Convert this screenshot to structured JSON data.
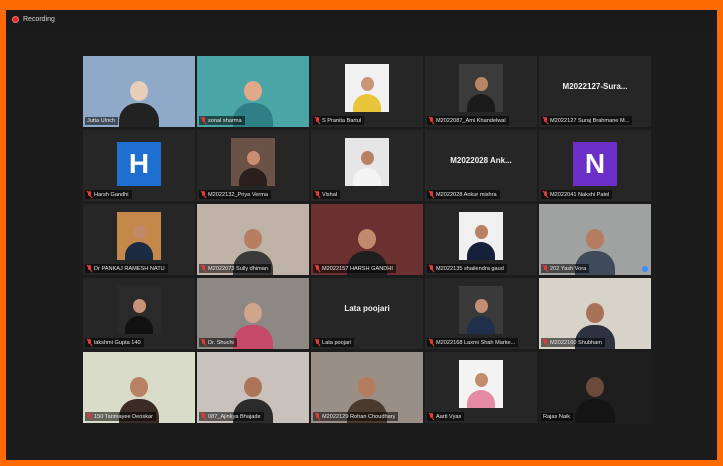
{
  "topbar": {
    "recording_label": "Recording"
  },
  "colors": {
    "frame": "#ff6a00",
    "active_speaker": "#d8e23a",
    "mic_muted": "#e23a3a",
    "avatar_h": "#1f6fd0",
    "avatar_n": "#6b2fc8"
  },
  "participants": [
    {
      "label": "Jutta Ulrich",
      "muted": false,
      "kind": "video",
      "bg": "#8fa9c8",
      "skin": "#e8cdb8",
      "shirt": "#222",
      "active": true
    },
    {
      "label": "sonal sharma",
      "muted": true,
      "kind": "video",
      "bg": "#4aa6a6",
      "skin": "#e0a98a",
      "shirt": "#2f7f86"
    },
    {
      "label": "S Pranita Bartul",
      "muted": true,
      "kind": "thumb",
      "bg": "#f1f1f1",
      "skin": "#c99677",
      "shirt": "#e8c53a"
    },
    {
      "label": "M2022087_Ami Khandelwal",
      "muted": true,
      "kind": "thumb",
      "bg": "#3b3b3b",
      "skin": "#b98567",
      "shirt": "#1b1b1b"
    },
    {
      "label": "M2022127 Suraj Brahmane M...",
      "muted": true,
      "kind": "name",
      "name_text": "M2022127-Sura..."
    },
    {
      "label": "Harsh Gandhi",
      "muted": true,
      "kind": "avatar",
      "letter": "H",
      "avatar_color": "#1f6fd0"
    },
    {
      "label": "M2022132_Priya Verma",
      "muted": true,
      "kind": "thumb",
      "bg": "#6a5246",
      "skin": "#c98d70",
      "shirt": "#2a1f1c"
    },
    {
      "label": "Vishal",
      "muted": true,
      "kind": "thumb",
      "bg": "#e6e6e6",
      "skin": "#b98063",
      "shirt": "#f4f4f4"
    },
    {
      "label": "M2022028 Ankur mishra",
      "muted": true,
      "kind": "name",
      "name_text": "M2022028 Ank..."
    },
    {
      "label": "M2022041 Nakshi Patel",
      "muted": true,
      "kind": "avatar",
      "letter": "N",
      "avatar_color": "#6b2fc8"
    },
    {
      "label": "Dr PANKAJ RAMESH NATU",
      "muted": true,
      "kind": "thumb",
      "bg": "#c4884a",
      "skin": "#c08a68",
      "shirt": "#1c2a44"
    },
    {
      "label": "M2022073 Sully dhiman",
      "muted": true,
      "kind": "video",
      "bg": "#bfb3a7",
      "skin": "#b77e61",
      "shirt": "#3a3a3a"
    },
    {
      "label": "M2022157 HARSH GANDHI",
      "muted": true,
      "kind": "video",
      "bg": "#6b3030",
      "skin": "#c08a6d",
      "shirt": "#1f1f1f"
    },
    {
      "label": "M2022135 shailendra gaud",
      "muted": true,
      "kind": "thumb",
      "bg": "#f0f0f0",
      "skin": "#b88064",
      "shirt": "#15203a"
    },
    {
      "label": "202 Yash Vora",
      "muted": true,
      "kind": "video",
      "bg": "#9fa2a0",
      "skin": "#b57c60",
      "shirt": "#3f4a5a",
      "pin": true
    },
    {
      "label": "lakshmi Gupta 140",
      "muted": true,
      "kind": "thumb",
      "bg": "#2a2a2a",
      "skin": "#c49378",
      "shirt": "#111"
    },
    {
      "label": "Dr. Shuchi",
      "muted": true,
      "kind": "video",
      "bg": "#8d8884",
      "skin": "#d0a58c",
      "shirt": "#c54a6a"
    },
    {
      "label": "Lata poojari",
      "muted": true,
      "kind": "name",
      "name_text": "Lata poojari"
    },
    {
      "label": "M2022168 Laxmi Shah Marke...",
      "muted": true,
      "kind": "thumb",
      "bg": "#3a3a3a",
      "skin": "#c28f73",
      "shirt": "#20304a"
    },
    {
      "label": "M2022160 Shubham",
      "muted": true,
      "kind": "video",
      "bg": "#d8d3c8",
      "skin": "#a87258",
      "shirt": "#2d3140"
    },
    {
      "label": "150 Tanmayee Deoskar",
      "muted": true,
      "kind": "video",
      "bg": "#d9dcc8",
      "skin": "#b98062",
      "shirt": "#3a2b25"
    },
    {
      "label": "087_Ajinkya Bhajade",
      "muted": true,
      "kind": "video",
      "bg": "#c9c2bc",
      "skin": "#ad7558",
      "shirt": "#2b2b2b"
    },
    {
      "label": "M2022129 Rohan Choudhary",
      "muted": true,
      "kind": "video",
      "bg": "#9a8f86",
      "skin": "#b57b5e",
      "shirt": "#4a3a2e"
    },
    {
      "label": "Aarti Vyas",
      "muted": true,
      "kind": "thumb",
      "bg": "#f3f3f3",
      "skin": "#c48c6f",
      "shirt": "#e48aa6"
    },
    {
      "label": "Rajas Naik",
      "muted": false,
      "kind": "video",
      "bg": "#1e1e1e",
      "skin": "#6a4a3a",
      "shirt": "#141414"
    }
  ]
}
